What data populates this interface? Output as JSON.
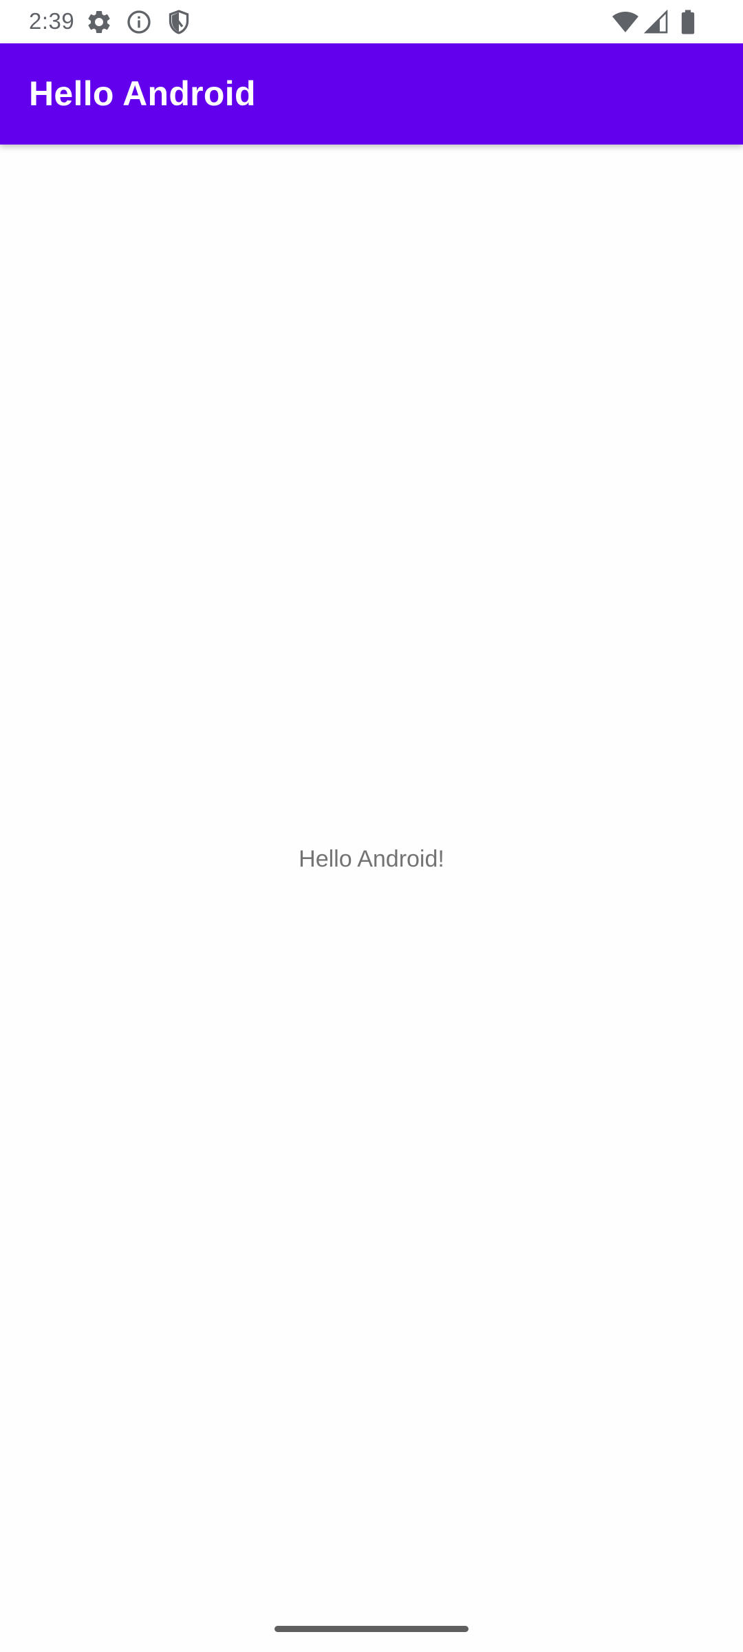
{
  "status_bar": {
    "time": "2:39",
    "left_icons": [
      "gear-icon",
      "info-icon",
      "shield-icon"
    ],
    "right_icons": [
      "wifi-icon",
      "cellular-signal-icon",
      "battery-icon"
    ]
  },
  "app_bar": {
    "title": "Hello Android",
    "color": "#6200ee"
  },
  "content": {
    "message": "Hello Android!"
  }
}
